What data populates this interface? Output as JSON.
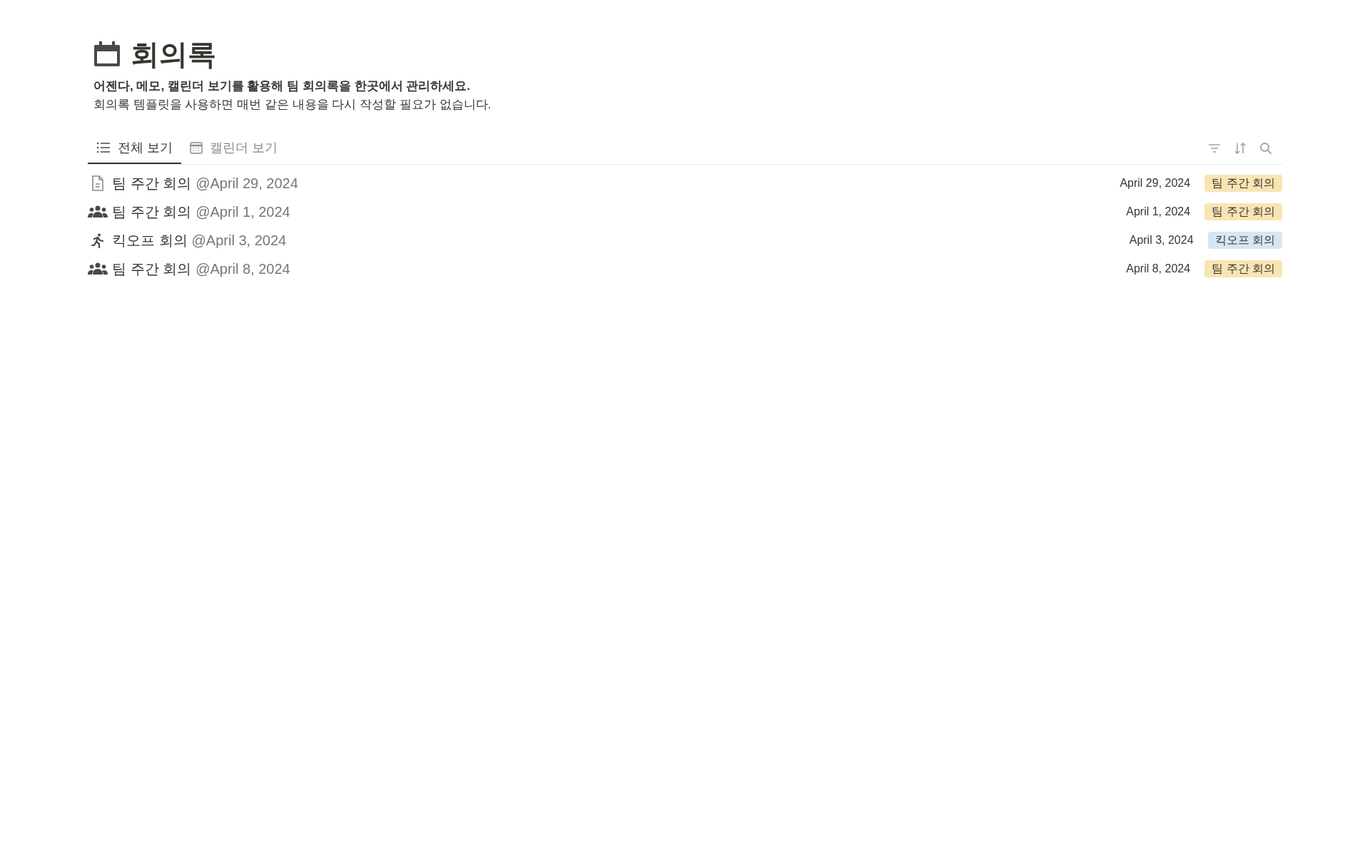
{
  "page": {
    "title": "회의록",
    "description_bold": "어젠다, 메모, 캘린더 보기를 활용해 팀 회의록을 한곳에서 관리하세요.",
    "description": "회의록 템플릿을 사용하면 매번 같은 내용을 다시 작성할 필요가 없습니다."
  },
  "tabs": [
    {
      "label": "전체 보기",
      "kind": "list",
      "selected": true
    },
    {
      "label": "캘린더 보기",
      "kind": "calendar",
      "selected": false
    }
  ],
  "rows": [
    {
      "kind": "document",
      "title": "팀 주간 회의",
      "mention": "@April 29, 2024",
      "date": "April 29, 2024",
      "tag": "팀 주간 회의",
      "color": "#f8e5b4"
    },
    {
      "kind": "people",
      "title": "팀 주간 회의",
      "mention": "@April 1, 2024",
      "date": "April 1, 2024",
      "tag": "팀 주간 회의",
      "color": "#f8e5b4"
    },
    {
      "kind": "runner",
      "title": "킥오프 회의",
      "mention": "@April 3, 2024",
      "date": "April 3, 2024",
      "tag": "킥오프 회의",
      "color": "#d6e7f3"
    },
    {
      "kind": "people",
      "title": "팀 주간 회의",
      "mention": "@April 8, 2024",
      "date": "April 8, 2024",
      "tag": "팀 주간 회의",
      "color": "#f8e5b4"
    }
  ]
}
